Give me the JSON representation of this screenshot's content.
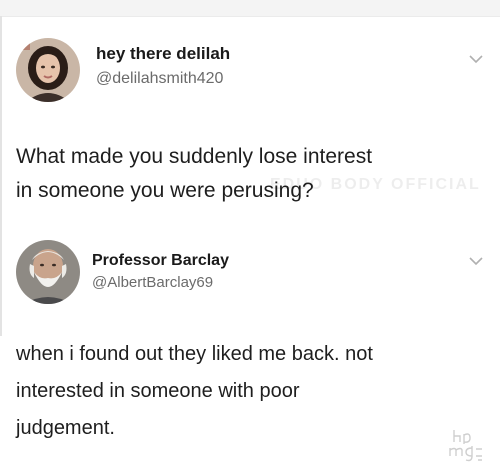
{
  "tweets": [
    {
      "display_name": "hey there delilah",
      "handle": "@delilahsmith420",
      "text": "What made you suddenly lose interest\nin someone you were perusing?",
      "avatar": "woman-portrait"
    },
    {
      "display_name": "Professor Barclay",
      "handle": "@AlbertBarclay69",
      "text": "when i found out they liked me back. not\ninterested in someone with poor\njudgement.",
      "avatar": "bearded-man-portrait"
    }
  ],
  "icons": {
    "more": "chevron-down-icon"
  },
  "watermark": {
    "faint_text": "EDUO BODY  OFFICIAL",
    "logo": "9gag-style-logo"
  },
  "colors": {
    "name": "#1a1a1a",
    "handle": "#6b6b6b",
    "chevron": "#b0b0b0"
  }
}
